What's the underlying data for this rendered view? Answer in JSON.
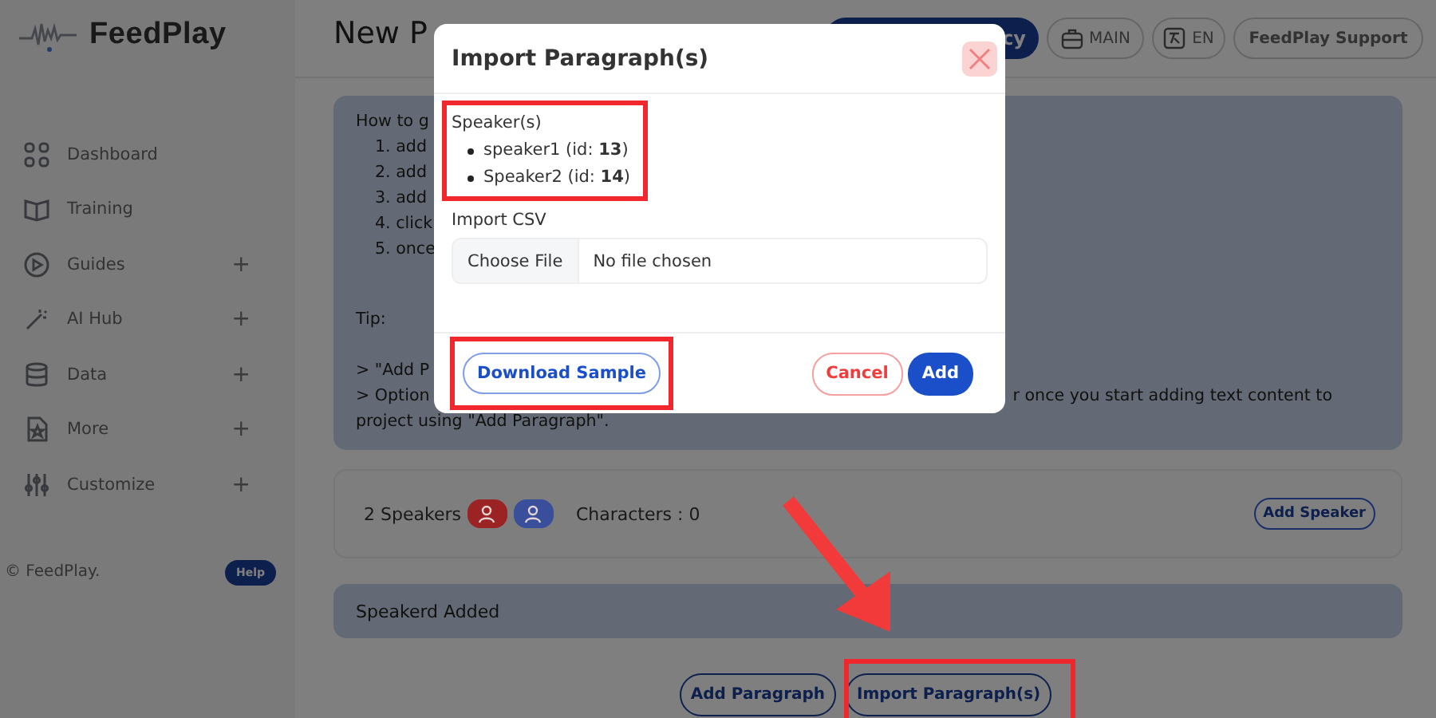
{
  "sidebar": {
    "logo": "FeedPlay",
    "items": [
      {
        "label": "Dashboard"
      },
      {
        "label": "Training"
      },
      {
        "label": "Guides",
        "toggle": "+"
      },
      {
        "label": "AI Hub",
        "toggle": "+"
      },
      {
        "label": "Data",
        "toggle": "+"
      },
      {
        "label": "More",
        "toggle": "+"
      },
      {
        "label": "Customize",
        "toggle": "+"
      }
    ],
    "footer": "© FeedPlay.",
    "help": "Help"
  },
  "header": {
    "title": "New P",
    "primary_button": "cy",
    "buttons": [
      {
        "label": "MAIN"
      },
      {
        "label": "EN"
      },
      {
        "label": "FeedPlay Support"
      }
    ]
  },
  "guide": {
    "heading": "How to g",
    "steps": [
      "1. add",
      "2. add",
      "3. add",
      "4. click",
      "5. once"
    ],
    "tip": "Tip:",
    "tip_line": "> \"Add P",
    "options_left": "> Option",
    "options_right": "r once you start adding text content to",
    "last_line": "project using \"Add Paragraph\"."
  },
  "speakers_bar": {
    "count": "2 Speakers",
    "avatars": [
      {
        "color": "#9c2323"
      },
      {
        "color": "#3a4f9c"
      }
    ],
    "characters": "Characters : 0",
    "add_button": "Add Speaker"
  },
  "notice": "Speakerd Added",
  "actions": [
    "Add Paragraph",
    "Import Paragraph(s)"
  ],
  "modal": {
    "title": "Import Paragraph(s)",
    "speakers_label": "Speaker(s)",
    "speakers": [
      "speaker1 (id: **13**)",
      "Speaker2 (id: **14**)"
    ],
    "import_label": "Import CSV",
    "file_button": "Choose File",
    "file_status": "No file chosen",
    "download": "Download Sample",
    "cancel": "Cancel",
    "add": "Add"
  }
}
